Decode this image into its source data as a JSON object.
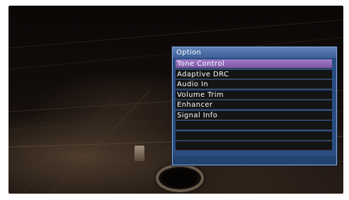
{
  "menu": {
    "title": "Option",
    "items": [
      {
        "label": "Tone Control"
      },
      {
        "label": "Adaptive DRC"
      },
      {
        "label": "Audio In"
      },
      {
        "label": "Volume Trim"
      },
      {
        "label": "Enhancer"
      },
      {
        "label": "Signal Info"
      },
      {
        "label": ""
      },
      {
        "label": ""
      },
      {
        "label": ""
      }
    ],
    "selected_index": 0
  },
  "colors": {
    "panel_bg": "#2a4d82",
    "highlight": "#8a67b5",
    "item_bg": "#141414"
  }
}
